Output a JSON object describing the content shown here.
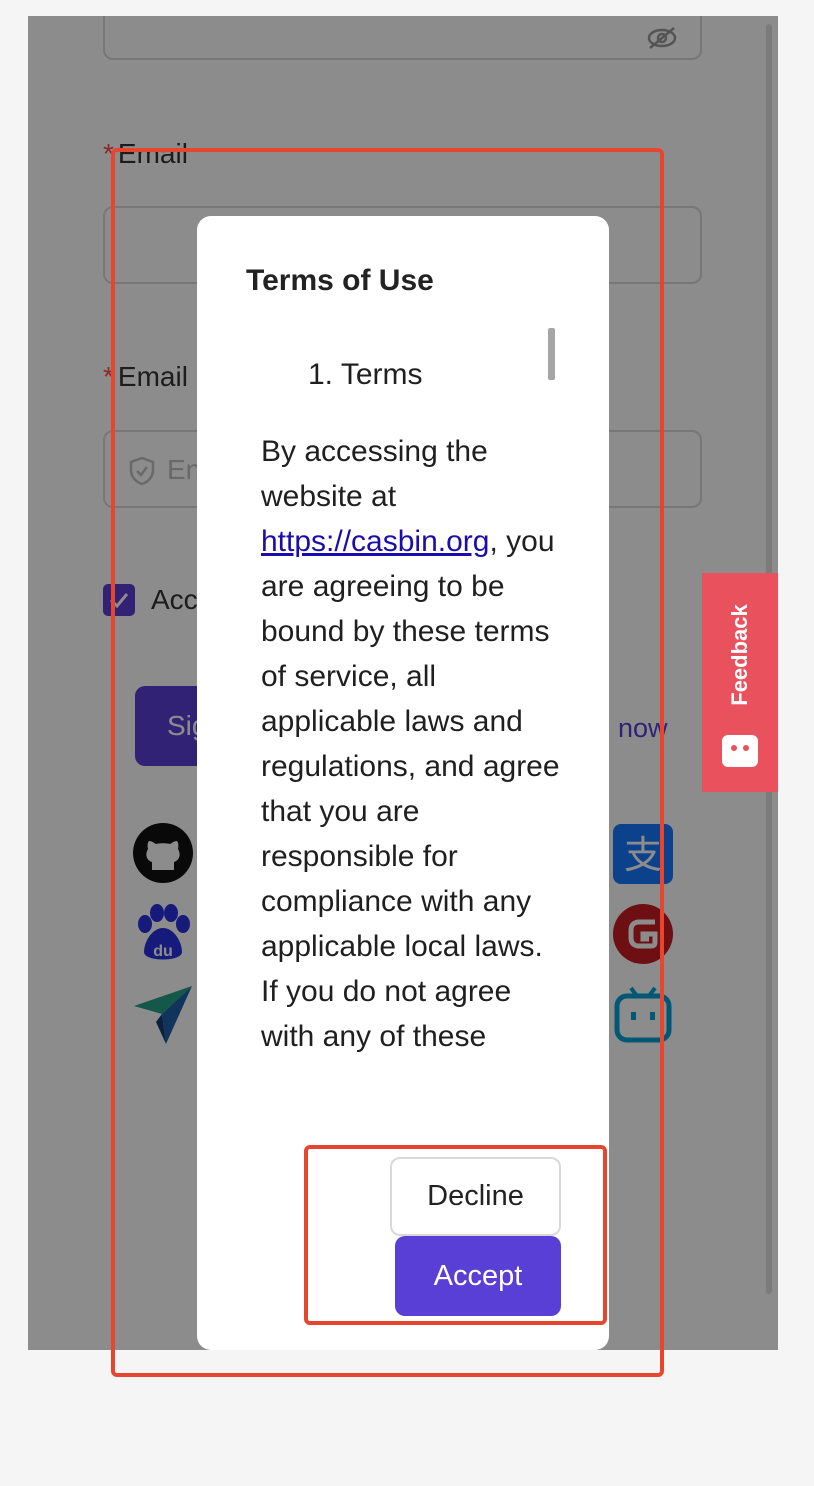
{
  "form": {
    "email_label": "Email",
    "code_label": "Email Code",
    "code_placeholder": "Enter Code",
    "agreement_text": "Accept",
    "signup_button": "Sign up",
    "signin_link": "now"
  },
  "modal": {
    "title": "Terms of Use",
    "heading": "1. Terms",
    "body_before_link": "By accessing the website at ",
    "link": "https://casbin.org",
    "body_after_link": ", you are agreeing to be bound by these terms of service, all applicable laws and regulations, and agree that you are responsible for compliance with any applicable local laws. If you do not agree with any of these",
    "decline_label": "Decline",
    "accept_label": "Accept"
  },
  "feedback": {
    "label": "Feedback"
  },
  "colors": {
    "accent": "#5a3fd6",
    "feedback": "#e9515c",
    "annotation": "#e8452e"
  },
  "icons": [
    "eye-invisible-icon",
    "shield-icon",
    "check-icon",
    "github-icon",
    "baidu-icon",
    "paper-plane-icon",
    "alipay-icon",
    "gitee-icon",
    "bilibili-icon",
    "feedback-face-icon"
  ]
}
